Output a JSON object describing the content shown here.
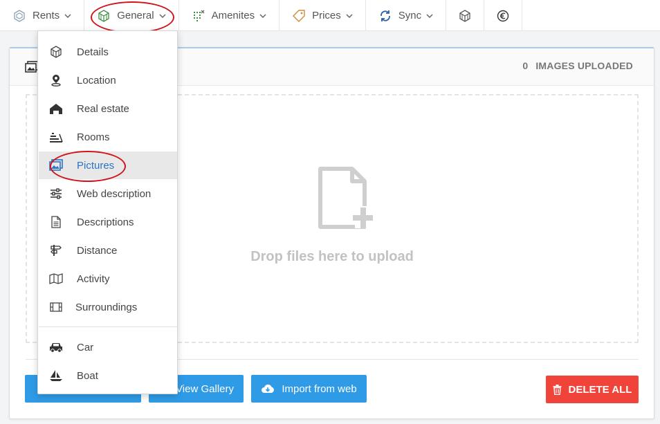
{
  "nav": {
    "rents": {
      "label": "Rents",
      "icon": "cube-outline-icon"
    },
    "general": {
      "label": "General",
      "icon": "cube-green-icon"
    },
    "amenities": {
      "label": "Amenites",
      "icon": "grid-dots-icon"
    },
    "prices": {
      "label": "Prices",
      "icon": "tag-icon"
    },
    "sync": {
      "label": "Sync",
      "icon": "sync-icon"
    },
    "cube_icon": "cube-icon",
    "euro_icon": "euro-icon"
  },
  "dropdown": {
    "items": [
      {
        "label": "Details",
        "icon": "cube-icon"
      },
      {
        "label": "Location",
        "icon": "map-pin-icon"
      },
      {
        "label": "Real estate",
        "icon": "house-icon"
      },
      {
        "label": "Rooms",
        "icon": "stairs-icon"
      },
      {
        "label": "Pictures",
        "icon": "pictures-icon",
        "active": true
      },
      {
        "label": "Web description",
        "icon": "sliders-icon"
      },
      {
        "label": "Descriptions",
        "icon": "document-icon"
      },
      {
        "label": "Distance",
        "icon": "signpost-icon"
      },
      {
        "label": "Activity",
        "icon": "map-icon"
      },
      {
        "label": "Surroundings",
        "icon": "film-icon"
      }
    ],
    "extra_items": [
      {
        "label": "Car",
        "icon": "car-icon"
      },
      {
        "label": "Boat",
        "icon": "sailboat-icon"
      }
    ]
  },
  "card": {
    "images_count": "0",
    "images_label": "IMAGES UPLOADED",
    "drop_text": "Drop files here to upload"
  },
  "buttons": {
    "view_gallery": "View Gallery",
    "import_from_web": "Import from web",
    "delete_all": "DELETE ALL"
  },
  "colors": {
    "primary_blue": "#2f9be6",
    "danger_red": "#f0443a",
    "active_text": "#2a73c5",
    "annotation_red": "#d0141b"
  }
}
